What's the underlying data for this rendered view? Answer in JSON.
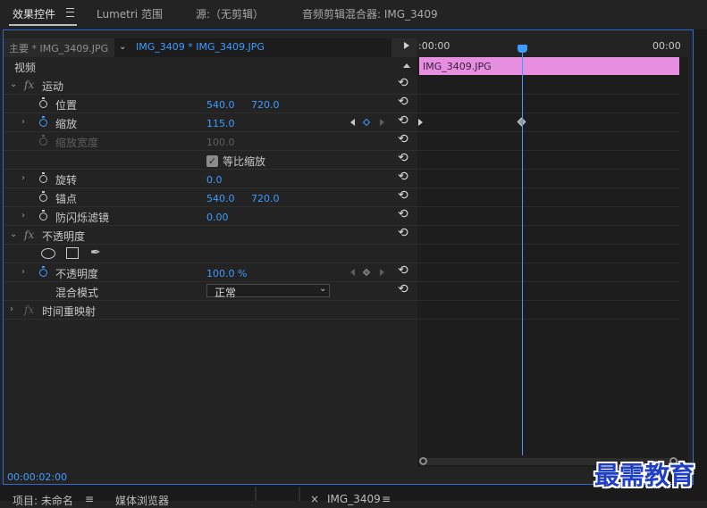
{
  "tabs": [
    {
      "label": "效果控件",
      "active": true
    },
    {
      "label": "Lumetri 范围"
    },
    {
      "label": "源:（无剪辑）"
    },
    {
      "label": "音频剪辑混合器: IMG_3409"
    }
  ],
  "sequence": {
    "master": "主要 * IMG_3409.JPG",
    "clip": "IMG_3409 * IMG_3409.JPG"
  },
  "ruler": {
    "start": ":00:00",
    "end": "00:00"
  },
  "clip_name": "IMG_3409.JPG",
  "section_video": "视频",
  "effects": {
    "motion": {
      "label": "运动",
      "position": {
        "label": "位置",
        "x": "540.0",
        "y": "720.0"
      },
      "scale": {
        "label": "缩放",
        "value": "115.0"
      },
      "scale_width": {
        "label": "缩放宽度",
        "value": "100.0"
      },
      "uniform_scale": {
        "label": "等比缩放",
        "checked": true
      },
      "rotation": {
        "label": "旋转",
        "value": "0.0"
      },
      "anchor": {
        "label": "锚点",
        "x": "540.0",
        "y": "720.0"
      },
      "anti_flicker": {
        "label": "防闪烁滤镜",
        "value": "0.00"
      }
    },
    "opacity": {
      "label": "不透明度",
      "opacity": {
        "label": "不透明度",
        "value": "100.0 %"
      },
      "blend_mode": {
        "label": "混合模式",
        "value": "正常"
      }
    },
    "time_remap": {
      "label": "时间重映射"
    }
  },
  "fx_label": "fx",
  "timecode": "00:00:02:00",
  "bottom_tabs": {
    "project": "项目: 未命名",
    "media": "媒体浏览器",
    "sequence": "IMG_3409"
  },
  "watermark": "最需教育",
  "colors": {
    "accent": "#3f9cff",
    "clip": "#e68ee0",
    "frame": "#2b6cd6"
  }
}
